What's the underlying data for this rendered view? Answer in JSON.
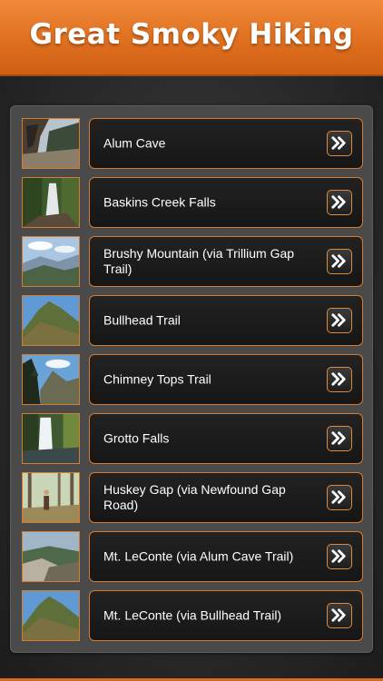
{
  "header": {
    "title": "Great Smoky Hiking"
  },
  "trails": [
    {
      "label": "Alum Cave",
      "image": "cave-rock-photo"
    },
    {
      "label": "Baskins Creek Falls",
      "image": "waterfall-forest-photo"
    },
    {
      "label": "Brushy Mountain (via Trillium Gap Trail)",
      "image": "mountain-vista-photo"
    },
    {
      "label": "Bullhead Trail",
      "image": "mountain-peak-photo"
    },
    {
      "label": "Chimney Tops Trail",
      "image": "forest-peak-photo"
    },
    {
      "label": "Grotto Falls",
      "image": "waterfall-photo"
    },
    {
      "label": "Huskey Gap (via Newfound Gap Road)",
      "image": "hiker-forest-photo"
    },
    {
      "label": "Mt. LeConte (via Alum Cave Trail)",
      "image": "rocky-overlook-photo"
    },
    {
      "label": "Mt. LeConte (via Bullhead Trail)",
      "image": "mountain-peak-photo"
    }
  ],
  "colors": {
    "accent": "#e0701f",
    "border": "#d87a2a"
  }
}
